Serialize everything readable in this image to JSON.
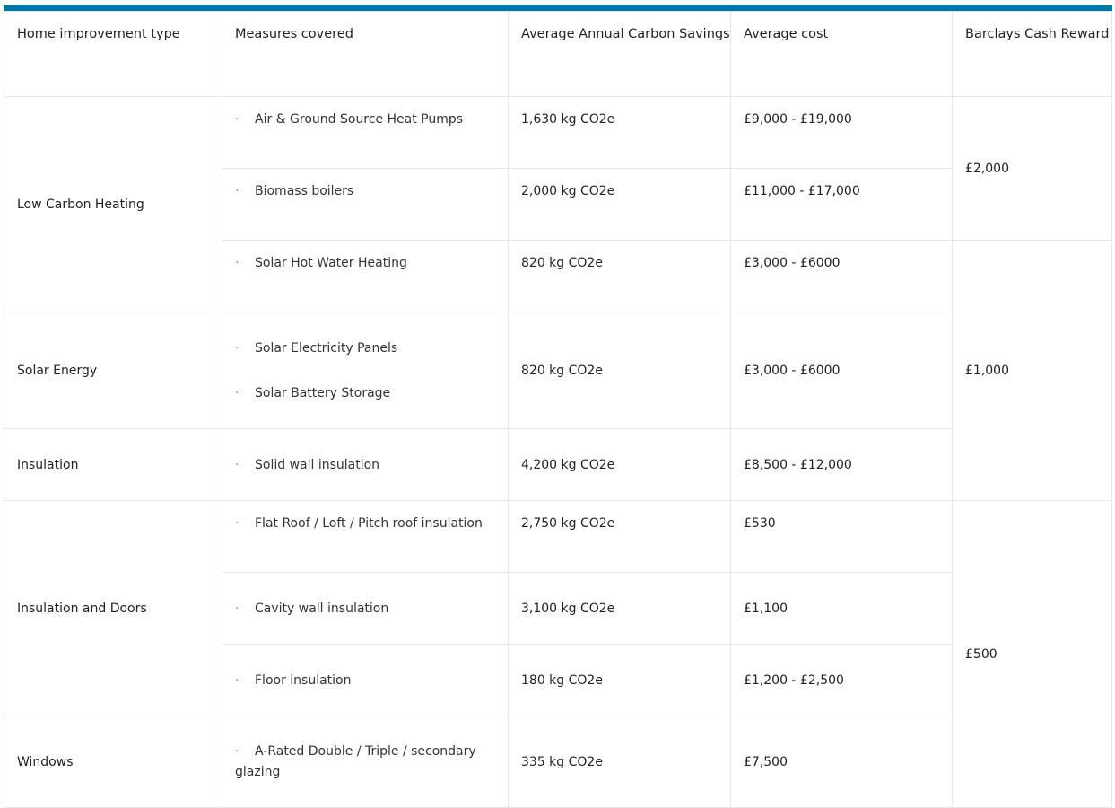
{
  "header": {
    "col1": "Home improvement type",
    "col2": "Measures covered",
    "col3": "Average Annual Carbon Savings",
    "col4": "Average cost",
    "col5": "Barclays Cash Reward"
  },
  "bullet": "·",
  "groups": {
    "low_carbon_heating": "Low Carbon Heating",
    "solar_energy": "Solar Energy",
    "insulation": "Insulation",
    "insulation_doors": "Insulation and Doors",
    "windows": "Windows"
  },
  "rows": [
    {
      "measure": "Air & Ground Source Heat Pumps",
      "savings": "1,630 kg CO2e",
      "cost": "£9,000 - £19,000"
    },
    {
      "measure": "Biomass boilers",
      "savings": "2,000 kg CO2e",
      "cost": "£11,000 - £17,000"
    },
    {
      "measure": "Solar Hot Water Heating",
      "savings": "820 kg CO2e",
      "cost": "£3,000 - £6000"
    },
    {
      "measure": "Solar Electricity Panels",
      "measure2": "Solar Battery Storage",
      "savings": "820 kg CO2e",
      "cost": "£3,000 - £6000"
    },
    {
      "measure": "Solid wall insulation",
      "savings": "4,200 kg CO2e",
      "cost": "£8,500 - £12,000"
    },
    {
      "measure": "Flat Roof / Loft / Pitch roof insulation",
      "savings": "2,750 kg CO2e",
      "cost": "£530"
    },
    {
      "measure": "Cavity wall insulation",
      "savings": "3,100 kg CO2e",
      "cost": "£1,100"
    },
    {
      "measure": "Floor insulation",
      "savings": "180 kg CO2e",
      "cost": "£1,200 - £2,500"
    },
    {
      "measure": "A-Rated Double / Triple / secondary glazing",
      "savings": "335 kg CO2e",
      "cost": "£7,500"
    }
  ],
  "rewards": {
    "r1": "£2,000",
    "r2": "£1,000",
    "r3": "£500"
  }
}
